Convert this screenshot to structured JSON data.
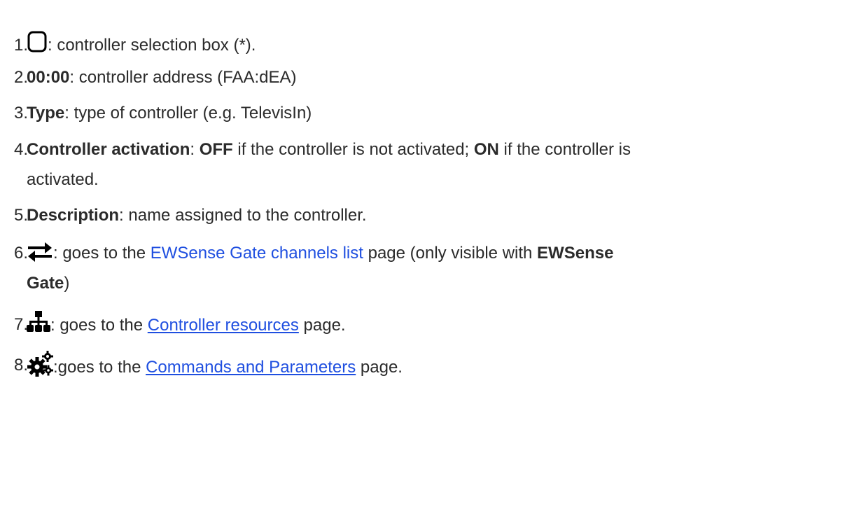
{
  "items": [
    {
      "num": "1.",
      "icon": "checkbox-outline-icon",
      "text": ": controller selection box (*)."
    },
    {
      "num": "2.",
      "bold": "00:00",
      "text": ": controller address (FAA:dEA)"
    },
    {
      "num": "3.",
      "bold": "Type",
      "text": ": type of controller (e.g. TelevisIn)"
    },
    {
      "num": "4.",
      "bold": "Controller activation",
      "sep": ": ",
      "off": "OFF",
      "mid": " if the controller is not activated; ",
      "on": "ON",
      "end": " if the controller is",
      "line2": "activated."
    },
    {
      "num": "5.",
      "bold": "Description",
      "text": ": name assigned to the controller."
    },
    {
      "num": "6.",
      "icon": "swap-arrows-icon",
      "pre": ": goes to the ",
      "link": "EWSense Gate channels list",
      "post": " page (only visible with ",
      "bold_end": "EWSense",
      "line2_bold": "Gate",
      "line2_end": ")"
    },
    {
      "num": "7.",
      "icon": "sitemap-icon",
      "pre": ": goes to the ",
      "link": "Controller resources",
      "post": " page."
    },
    {
      "num": "8.",
      "icon": "gears-icon",
      "pre": ":goes to the ",
      "link": "Commands and Parameters",
      "post": " page."
    }
  ]
}
